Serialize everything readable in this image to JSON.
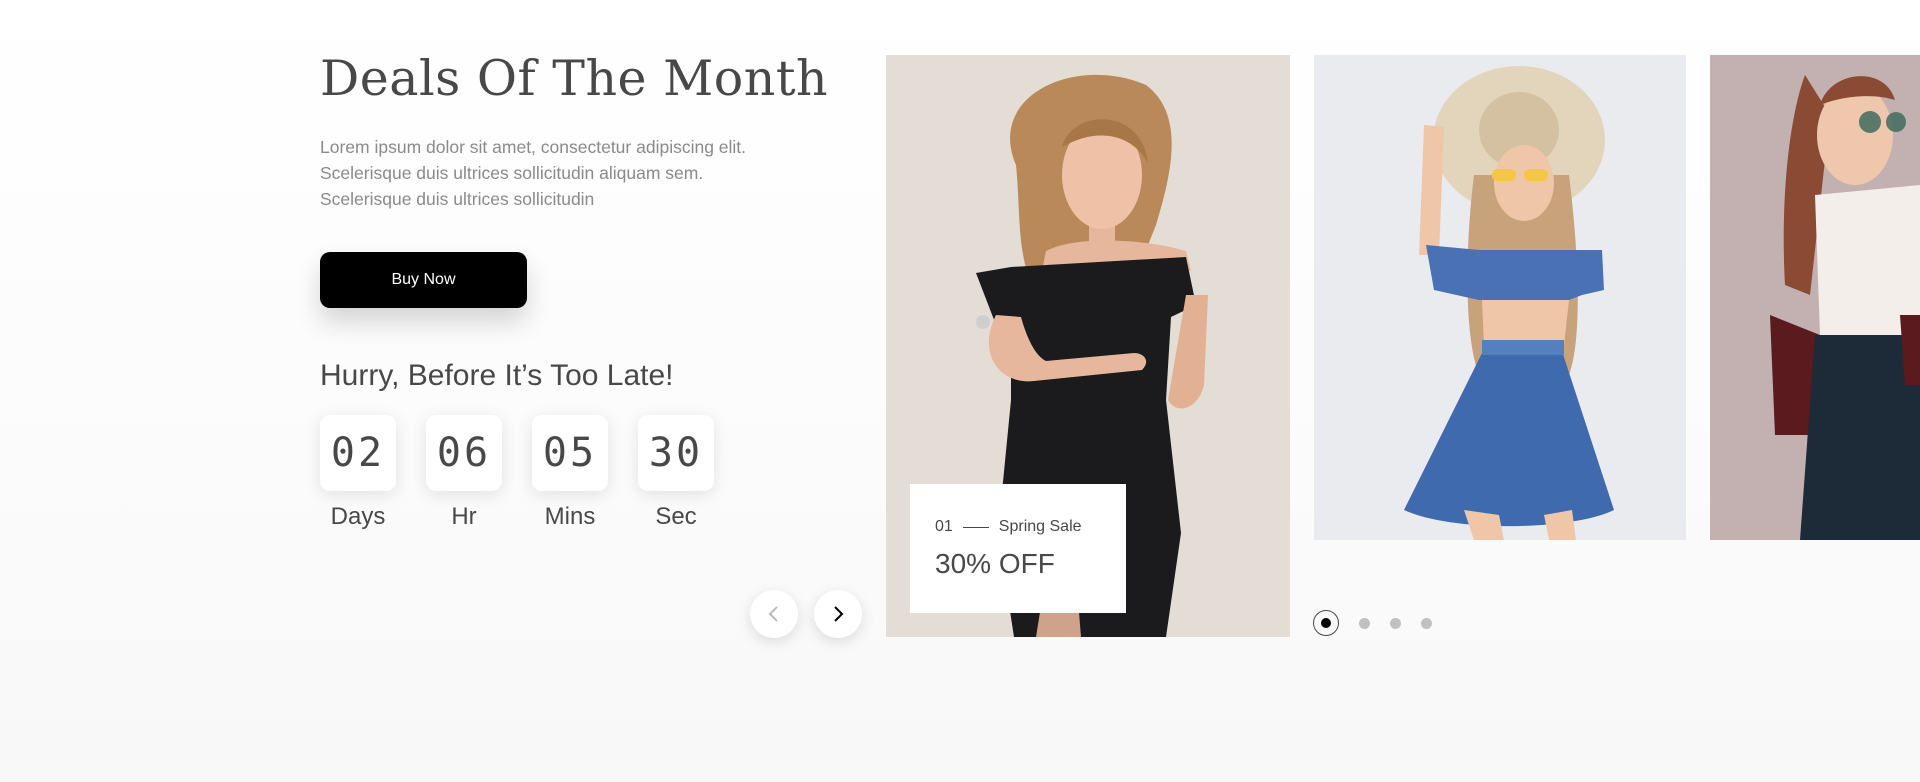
{
  "deals": {
    "title": "Deals Of The Month",
    "description": "Lorem ipsum dolor sit amet, consectetur adipiscing elit. Scelerisque duis ultrices sollicitudin aliquam sem. Scelerisque duis ultrices sollicitudin",
    "buy_label": "Buy Now",
    "hurry_text": "Hurry, Before It’s Too Late!"
  },
  "countdown": [
    {
      "value": "02",
      "label": "Days"
    },
    {
      "value": "06",
      "label": "Hr"
    },
    {
      "value": "05",
      "label": "Mins"
    },
    {
      "value": "30",
      "label": "Sec"
    }
  ],
  "carousel": {
    "prev_icon": "chevron-left-icon",
    "next_icon": "chevron-right-icon",
    "active_card": {
      "index": "01",
      "name": "Spring Sale",
      "discount": "30% OFF"
    },
    "dots_count": 4,
    "active_dot": 1
  },
  "colors": {
    "text": "#484848",
    "muted": "#8a8a8a",
    "button": "#000000",
    "inactive_dot": "#c1c1c1"
  }
}
